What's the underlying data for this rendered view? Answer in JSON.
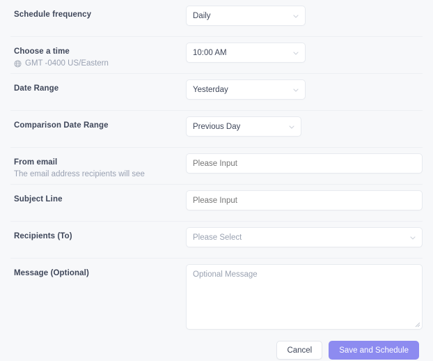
{
  "colors": {
    "page_background": "#f7f8fa",
    "divider": "#edeff3",
    "label_text": "#3f475a",
    "muted_text": "#99a1b2",
    "placeholder_text": "#9aa2b1",
    "control_border": "#e7eaef",
    "control_background": "#ffffff",
    "primary_button": "#8d8bf0",
    "primary_button_text": "#ffffff"
  },
  "form": {
    "rows": [
      {
        "label": "Schedule frequency",
        "sublabel": null,
        "control": "select",
        "value": "Daily"
      },
      {
        "label": "Choose a time",
        "sublabel": "GMT -0400 US/Eastern",
        "sublabel_icon": "globe-icon",
        "control": "select",
        "value": "10:00 AM"
      },
      {
        "label": "Date Range",
        "sublabel": null,
        "control": "select",
        "value": "Yesterday"
      },
      {
        "label": "Comparison Date Range",
        "sublabel": null,
        "control": "select",
        "value": "Previous Day"
      },
      {
        "label": "From email",
        "sublabel": "The email address recipients will see",
        "control": "input",
        "value": "",
        "placeholder": "Please Input"
      },
      {
        "label": "Subject Line",
        "sublabel": null,
        "control": "input",
        "value": "",
        "placeholder": "Please Input"
      },
      {
        "label": "Recipients (To)",
        "sublabel": null,
        "control": "select",
        "value": "",
        "placeholder": "Please Select"
      },
      {
        "label": "Message (Optional)",
        "sublabel": null,
        "control": "textarea",
        "value": "",
        "placeholder": "Optional Message"
      }
    ]
  },
  "footer": {
    "cancel_label": "Cancel",
    "submit_label": "Save and Schedule"
  }
}
